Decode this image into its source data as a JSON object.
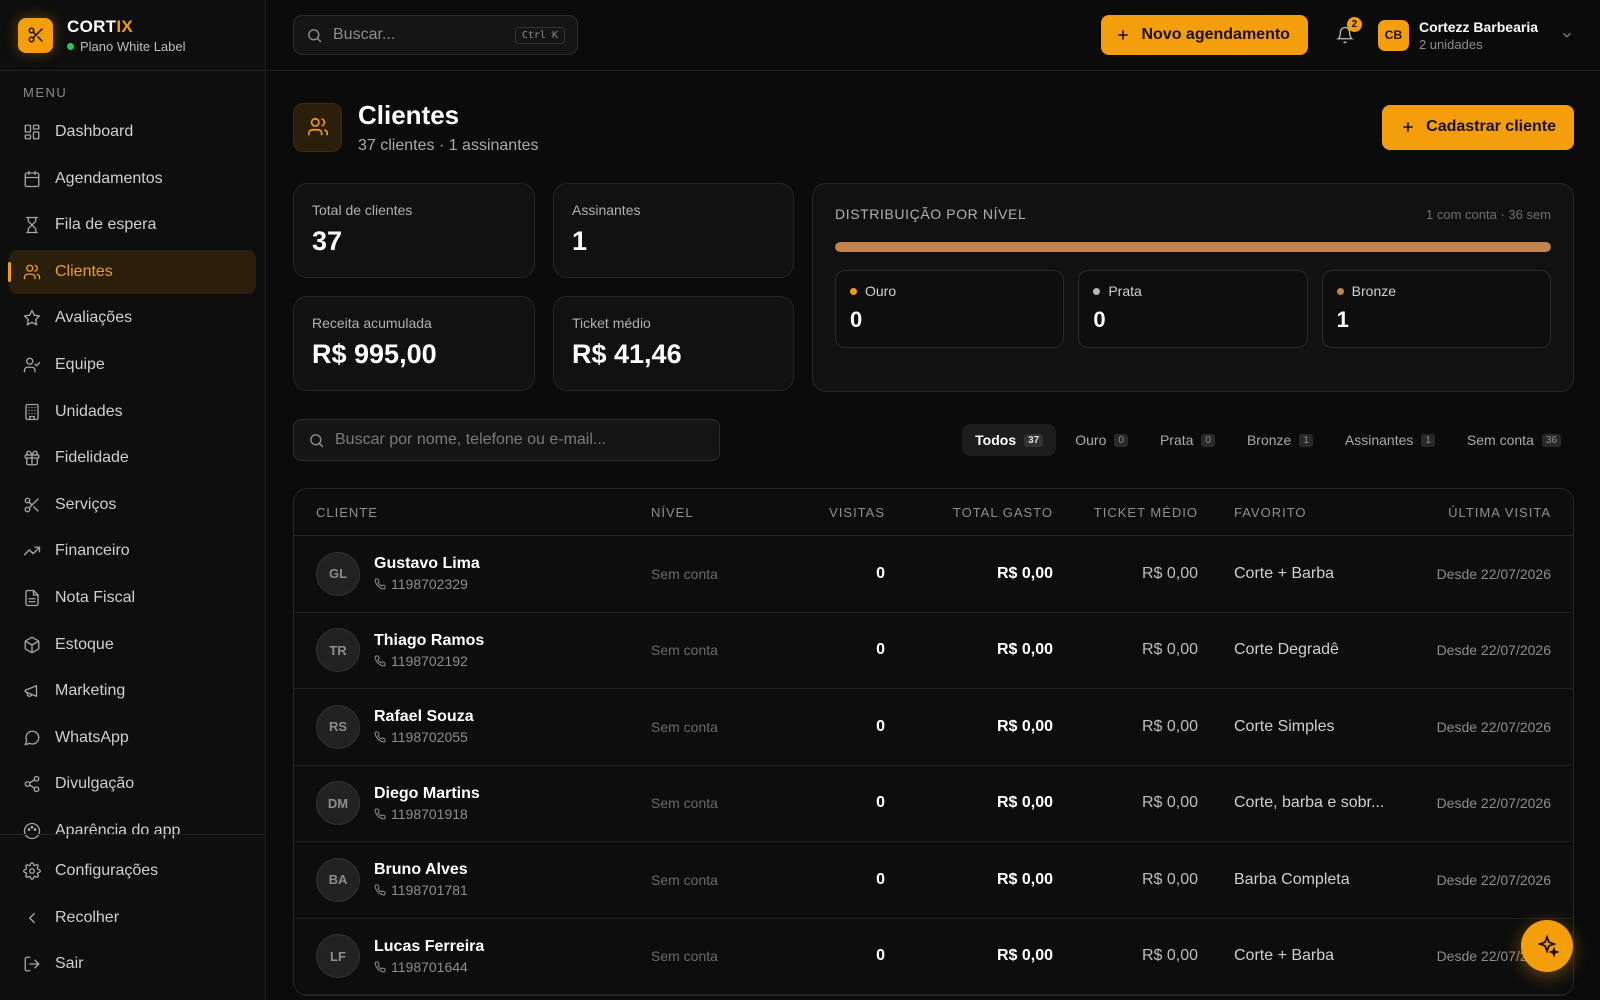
{
  "brand": {
    "name_main": "CORT",
    "name_accent": "IX",
    "plan": "Plano White Label"
  },
  "sidebar": {
    "menu_label": "MENU",
    "items": [
      {
        "label": "Dashboard",
        "icon": "dashboard-icon"
      },
      {
        "label": "Agendamentos",
        "icon": "calendar-icon"
      },
      {
        "label": "Fila de espera",
        "icon": "hourglass-icon"
      },
      {
        "label": "Clientes",
        "icon": "users-icon",
        "active": true
      },
      {
        "label": "Avaliações",
        "icon": "star-icon"
      },
      {
        "label": "Equipe",
        "icon": "user-check-icon"
      },
      {
        "label": "Unidades",
        "icon": "building-icon"
      },
      {
        "label": "Fidelidade",
        "icon": "gift-icon"
      },
      {
        "label": "Serviços",
        "icon": "scissors-icon"
      },
      {
        "label": "Financeiro",
        "icon": "trending-up-icon"
      },
      {
        "label": "Nota Fiscal",
        "icon": "file-text-icon"
      },
      {
        "label": "Estoque",
        "icon": "package-icon"
      },
      {
        "label": "Marketing",
        "icon": "megaphone-icon"
      },
      {
        "label": "WhatsApp",
        "icon": "message-circle-icon"
      },
      {
        "label": "Divulgação",
        "icon": "share-icon"
      },
      {
        "label": "Aparência do app",
        "icon": "palette-icon"
      }
    ],
    "bottom": [
      {
        "label": "Configurações",
        "icon": "gear-icon"
      },
      {
        "label": "Recolher",
        "icon": "chevron-left-icon"
      },
      {
        "label": "Sair",
        "icon": "logout-icon"
      }
    ]
  },
  "header": {
    "search_placeholder": "Buscar...",
    "search_shortcut": "Ctrl K",
    "new_button": "Novo agendamento",
    "notifications": "2",
    "account_initials": "CB",
    "account_name": "Cortezz Barbearia",
    "account_sub": "2 unidades"
  },
  "page": {
    "title": "Clientes",
    "subtitle": "37 clientes · 1 assinantes",
    "add_button": "Cadastrar cliente"
  },
  "stats": [
    {
      "label": "Total de clientes",
      "value": "37"
    },
    {
      "label": "Assinantes",
      "value": "1"
    },
    {
      "label": "Receita acumulada",
      "value": "R$ 995,00"
    },
    {
      "label": "Ticket médio",
      "value": "R$ 41,46"
    }
  ],
  "distribution": {
    "title": "DISTRIBUIÇÃO POR NÍVEL",
    "note": "1 com conta · 36 sem",
    "bar_fill_fraction": 1.0,
    "bar_color": "#c2844a",
    "tiers": [
      {
        "name": "Ouro",
        "value": "0",
        "color": "#f59e0b"
      },
      {
        "name": "Prata",
        "value": "0",
        "color": "#b8b8b8"
      },
      {
        "name": "Bronze",
        "value": "1",
        "color": "#c2844a"
      }
    ]
  },
  "table_search_placeholder": "Buscar por nome, telefone ou e-mail...",
  "filters": [
    {
      "label": "Todos",
      "count": "37",
      "active": true
    },
    {
      "label": "Ouro",
      "count": "0"
    },
    {
      "label": "Prata",
      "count": "0"
    },
    {
      "label": "Bronze",
      "count": "1"
    },
    {
      "label": "Assinantes",
      "count": "1"
    },
    {
      "label": "Sem conta",
      "count": "36"
    }
  ],
  "table": {
    "columns": [
      "CLIENTE",
      "NÍVEL",
      "VISITAS",
      "TOTAL GASTO",
      "TICKET MÉDIO",
      "FAVORITO",
      "ÚLTIMA VISITA"
    ],
    "rows": [
      {
        "initials": "GL",
        "name": "Gustavo Lima",
        "phone": "1198702329",
        "level": "Sem conta",
        "visits": "0",
        "total": "R$ 0,00",
        "ticket": "R$ 0,00",
        "favorite": "Corte + Barba",
        "last": "Desde 22/07/2026"
      },
      {
        "initials": "TR",
        "name": "Thiago Ramos",
        "phone": "1198702192",
        "level": "Sem conta",
        "visits": "0",
        "total": "R$ 0,00",
        "ticket": "R$ 0,00",
        "favorite": "Corte Degradê",
        "last": "Desde 22/07/2026"
      },
      {
        "initials": "RS",
        "name": "Rafael Souza",
        "phone": "1198702055",
        "level": "Sem conta",
        "visits": "0",
        "total": "R$ 0,00",
        "ticket": "R$ 0,00",
        "favorite": "Corte Simples",
        "last": "Desde 22/07/2026"
      },
      {
        "initials": "DM",
        "name": "Diego Martins",
        "phone": "1198701918",
        "level": "Sem conta",
        "visits": "0",
        "total": "R$ 0,00",
        "ticket": "R$ 0,00",
        "favorite": "Corte, barba e sobr...",
        "last": "Desde 22/07/2026"
      },
      {
        "initials": "BA",
        "name": "Bruno Alves",
        "phone": "1198701781",
        "level": "Sem conta",
        "visits": "0",
        "total": "R$ 0,00",
        "ticket": "R$ 0,00",
        "favorite": "Barba Completa",
        "last": "Desde 22/07/2026"
      },
      {
        "initials": "LF",
        "name": "Lucas Ferreira",
        "phone": "1198701644",
        "level": "Sem conta",
        "visits": "0",
        "total": "R$ 0,00",
        "ticket": "R$ 0,00",
        "favorite": "Corte + Barba",
        "last": "Desde 22/07/2026"
      }
    ]
  },
  "fab_icon": "sparkles-icon"
}
